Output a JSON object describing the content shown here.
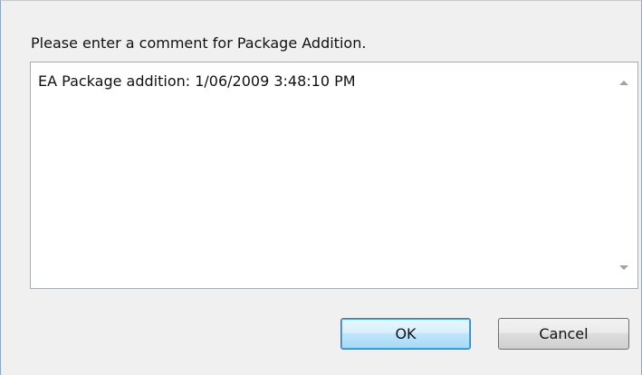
{
  "dialog": {
    "prompt": "Please enter a comment for Package Addition.",
    "comment_value": "EA Package addition: 1/06/2009 3:48:10 PM",
    "ok_label": "OK",
    "cancel_label": "Cancel"
  },
  "icons": {
    "scroll_up": "scroll-up-arrow-icon",
    "scroll_down": "scroll-down-arrow-icon"
  },
  "colors": {
    "dialog_background": "#f0f0f0",
    "ok_border": "#3c7fb1",
    "ok_fill": "#bee6fd"
  }
}
